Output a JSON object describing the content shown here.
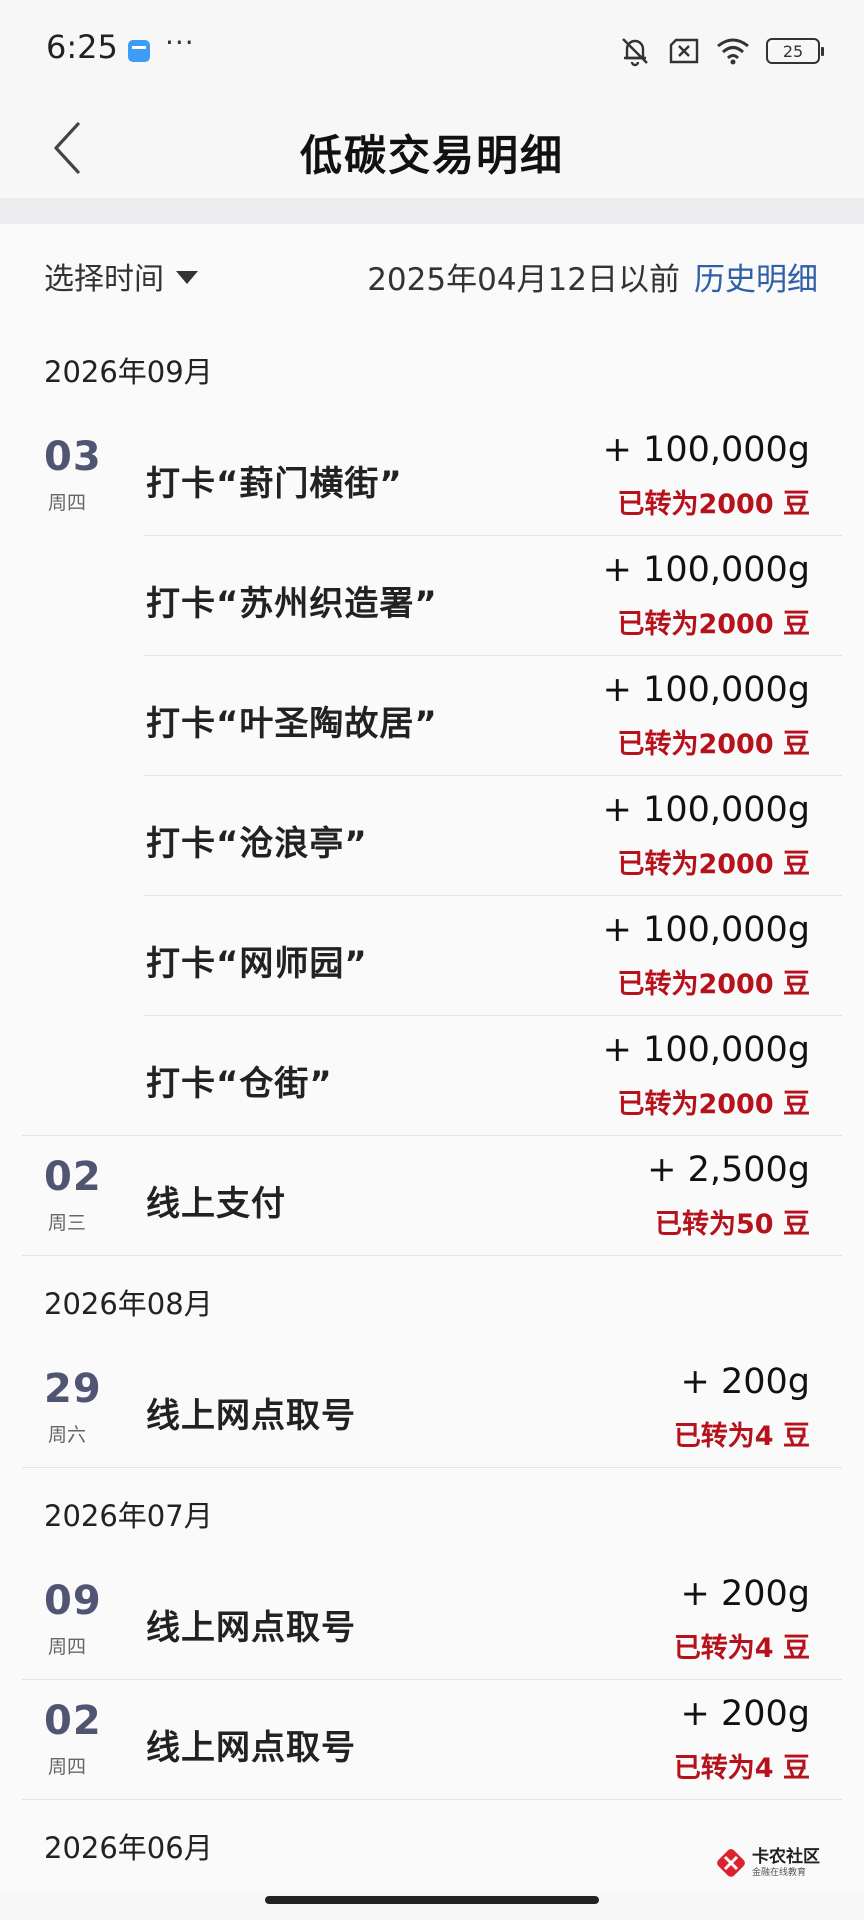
{
  "status_bar": {
    "time": "6:25",
    "more": "···",
    "battery": "25",
    "icons": [
      "app-notification-icon",
      "mute-icon",
      "sim-off-icon",
      "wifi-icon",
      "battery-icon"
    ]
  },
  "header": {
    "title": "低碳交易明细",
    "back_icon": "chevron-left-icon"
  },
  "filter": {
    "select_label": "选择时间",
    "cutoff_text": "2025年04月12日以前",
    "history_link": "历史明细"
  },
  "months": [
    {
      "label": "2026年09月",
      "rows": [
        {
          "day": "03",
          "weekday": "周四",
          "desc": "打卡“葑门横街”",
          "amount": "+ 100,000g",
          "converted": "已转为2000 豆"
        },
        {
          "day": "",
          "weekday": "",
          "desc": "打卡“苏州织造署”",
          "amount": "+ 100,000g",
          "converted": "已转为2000 豆"
        },
        {
          "day": "",
          "weekday": "",
          "desc": "打卡“叶圣陶故居”",
          "amount": "+ 100,000g",
          "converted": "已转为2000 豆"
        },
        {
          "day": "",
          "weekday": "",
          "desc": "打卡“沧浪亭”",
          "amount": "+ 100,000g",
          "converted": "已转为2000 豆"
        },
        {
          "day": "",
          "weekday": "",
          "desc": "打卡“网师园”",
          "amount": "+ 100,000g",
          "converted": "已转为2000 豆"
        },
        {
          "day": "",
          "weekday": "",
          "desc": "打卡“仓街”",
          "amount": "+ 100,000g",
          "converted": "已转为2000 豆"
        },
        {
          "day": "02",
          "weekday": "周三",
          "desc": "线上支付",
          "amount": "+ 2,500g",
          "converted": "已转为50 豆"
        }
      ]
    },
    {
      "label": "2026年08月",
      "rows": [
        {
          "day": "29",
          "weekday": "周六",
          "desc": "线上网点取号",
          "amount": "+ 200g",
          "converted": "已转为4 豆"
        }
      ]
    },
    {
      "label": "2026年07月",
      "rows": [
        {
          "day": "09",
          "weekday": "周四",
          "desc": "线上网点取号",
          "amount": "+ 200g",
          "converted": "已转为4 豆"
        },
        {
          "day": "02",
          "weekday": "周四",
          "desc": "线上网点取号",
          "amount": "+ 200g",
          "converted": "已转为4 豆"
        }
      ]
    },
    {
      "label": "2026年06月",
      "rows": []
    }
  ],
  "watermark": {
    "title": "卡农社区",
    "subtitle": "金融在线教育"
  },
  "colors": {
    "link": "#2f5fa6",
    "converted": "#b5121b",
    "date": "#4f5573"
  }
}
